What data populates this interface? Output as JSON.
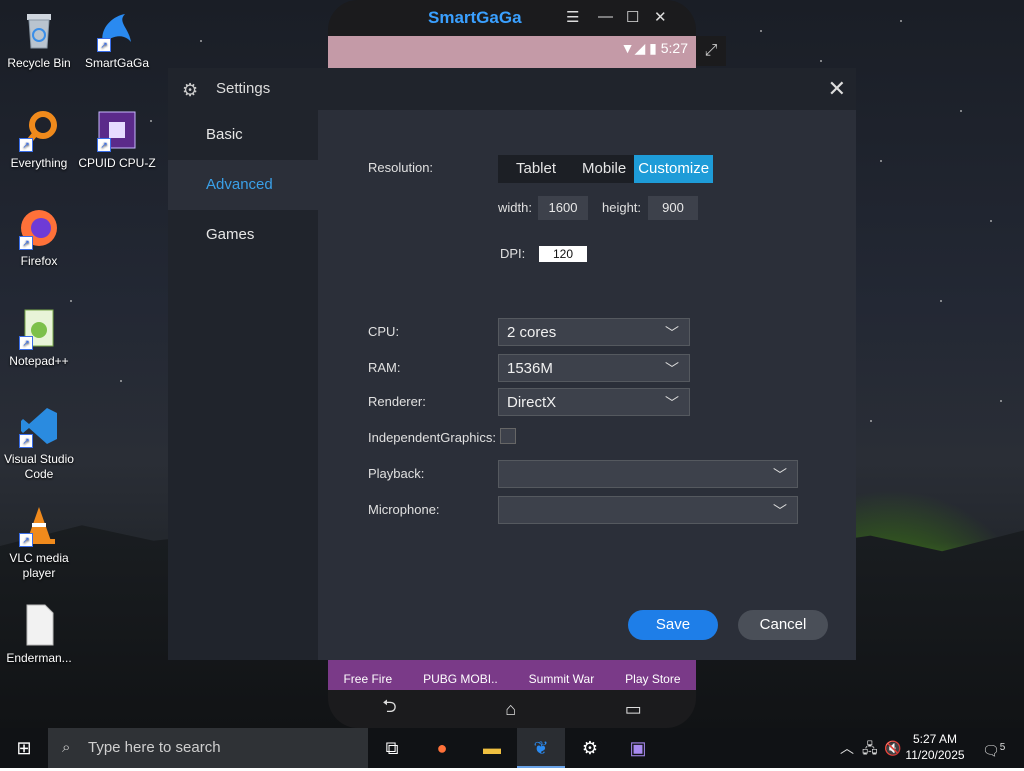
{
  "desktop": {
    "icons": [
      {
        "label": "Recycle Bin"
      },
      {
        "label": "SmartGaGa"
      },
      {
        "label": "Everything"
      },
      {
        "label": "CPUID CPU-Z"
      },
      {
        "label": "Firefox"
      },
      {
        "label": "Notepad++"
      },
      {
        "label": "Visual Studio Code"
      },
      {
        "label": "VLC media player"
      },
      {
        "label": "Enderman..."
      }
    ]
  },
  "emulator": {
    "brand": "SmartGaGa",
    "time": "5:27",
    "apps": [
      "Free Fire",
      "PUBG MOBI..",
      "Summit War",
      "Play Store"
    ]
  },
  "settings": {
    "title": "Settings",
    "nav": [
      "Basic",
      "Advanced",
      "Games"
    ],
    "active_nav": "Advanced",
    "resolution_label": "Resolution:",
    "resolution_modes": [
      "Tablet",
      "Mobile",
      "Customize"
    ],
    "selected_mode": "Customize",
    "width_label": "width:",
    "width_value": "1600",
    "height_label": "height:",
    "height_value": "900",
    "dpi_label": "DPI:",
    "dpi_value": "120",
    "cpu_label": "CPU:",
    "cpu_value": "2 cores",
    "ram_label": "RAM:",
    "ram_value": "1536M",
    "renderer_label": "Renderer:",
    "renderer_value": "DirectX",
    "graphics_label": "IndependentGraphics:",
    "playback_label": "Playback:",
    "playback_value": "",
    "microphone_label": "Microphone:",
    "microphone_value": "",
    "save": "Save",
    "cancel": "Cancel"
  },
  "taskbar": {
    "search_placeholder": "Type here to search",
    "time": "5:27 AM",
    "date": "11/20/2025",
    "notifications": "5"
  },
  "colors": {
    "accent": "#1e9cd8",
    "save_button": "#1e7ee8",
    "cancel_button": "#4a4f58"
  }
}
